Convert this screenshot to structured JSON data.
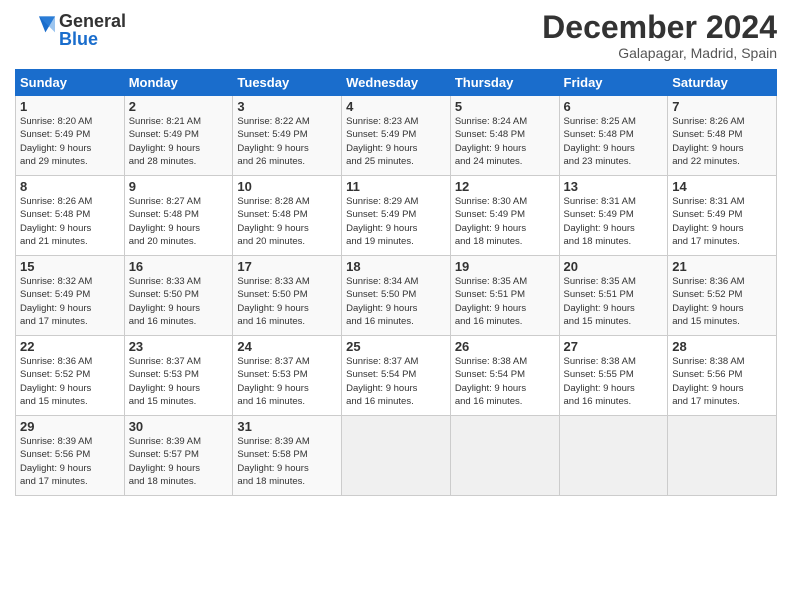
{
  "header": {
    "logo_general": "General",
    "logo_blue": "Blue",
    "month_title": "December 2024",
    "location": "Galapagar, Madrid, Spain"
  },
  "calendar": {
    "days_of_week": [
      "Sunday",
      "Monday",
      "Tuesday",
      "Wednesday",
      "Thursday",
      "Friday",
      "Saturday"
    ],
    "weeks": [
      [
        {
          "day": "",
          "info": ""
        },
        {
          "day": "",
          "info": ""
        },
        {
          "day": "",
          "info": ""
        },
        {
          "day": "",
          "info": ""
        },
        {
          "day": "5",
          "info": "Sunrise: 8:24 AM\nSunset: 5:48 PM\nDaylight: 9 hours\nand 24 minutes."
        },
        {
          "day": "6",
          "info": "Sunrise: 8:25 AM\nSunset: 5:48 PM\nDaylight: 9 hours\nand 23 minutes."
        },
        {
          "day": "7",
          "info": "Sunrise: 8:26 AM\nSunset: 5:48 PM\nDaylight: 9 hours\nand 22 minutes."
        }
      ],
      [
        {
          "day": "1",
          "info": "Sunrise: 8:20 AM\nSunset: 5:49 PM\nDaylight: 9 hours\nand 29 minutes."
        },
        {
          "day": "2",
          "info": "Sunrise: 8:21 AM\nSunset: 5:49 PM\nDaylight: 9 hours\nand 28 minutes."
        },
        {
          "day": "3",
          "info": "Sunrise: 8:22 AM\nSunset: 5:49 PM\nDaylight: 9 hours\nand 26 minutes."
        },
        {
          "day": "4",
          "info": "Sunrise: 8:23 AM\nSunset: 5:49 PM\nDaylight: 9 hours\nand 25 minutes."
        },
        {
          "day": "5",
          "info": "Sunrise: 8:24 AM\nSunset: 5:48 PM\nDaylight: 9 hours\nand 24 minutes."
        },
        {
          "day": "6",
          "info": "Sunrise: 8:25 AM\nSunset: 5:48 PM\nDaylight: 9 hours\nand 23 minutes."
        },
        {
          "day": "7",
          "info": "Sunrise: 8:26 AM\nSunset: 5:48 PM\nDaylight: 9 hours\nand 22 minutes."
        }
      ],
      [
        {
          "day": "8",
          "info": "Sunrise: 8:26 AM\nSunset: 5:48 PM\nDaylight: 9 hours\nand 21 minutes."
        },
        {
          "day": "9",
          "info": "Sunrise: 8:27 AM\nSunset: 5:48 PM\nDaylight: 9 hours\nand 20 minutes."
        },
        {
          "day": "10",
          "info": "Sunrise: 8:28 AM\nSunset: 5:48 PM\nDaylight: 9 hours\nand 20 minutes."
        },
        {
          "day": "11",
          "info": "Sunrise: 8:29 AM\nSunset: 5:49 PM\nDaylight: 9 hours\nand 19 minutes."
        },
        {
          "day": "12",
          "info": "Sunrise: 8:30 AM\nSunset: 5:49 PM\nDaylight: 9 hours\nand 18 minutes."
        },
        {
          "day": "13",
          "info": "Sunrise: 8:31 AM\nSunset: 5:49 PM\nDaylight: 9 hours\nand 18 minutes."
        },
        {
          "day": "14",
          "info": "Sunrise: 8:31 AM\nSunset: 5:49 PM\nDaylight: 9 hours\nand 17 minutes."
        }
      ],
      [
        {
          "day": "15",
          "info": "Sunrise: 8:32 AM\nSunset: 5:49 PM\nDaylight: 9 hours\nand 17 minutes."
        },
        {
          "day": "16",
          "info": "Sunrise: 8:33 AM\nSunset: 5:50 PM\nDaylight: 9 hours\nand 16 minutes."
        },
        {
          "day": "17",
          "info": "Sunrise: 8:33 AM\nSunset: 5:50 PM\nDaylight: 9 hours\nand 16 minutes."
        },
        {
          "day": "18",
          "info": "Sunrise: 8:34 AM\nSunset: 5:50 PM\nDaylight: 9 hours\nand 16 minutes."
        },
        {
          "day": "19",
          "info": "Sunrise: 8:35 AM\nSunset: 5:51 PM\nDaylight: 9 hours\nand 16 minutes."
        },
        {
          "day": "20",
          "info": "Sunrise: 8:35 AM\nSunset: 5:51 PM\nDaylight: 9 hours\nand 15 minutes."
        },
        {
          "day": "21",
          "info": "Sunrise: 8:36 AM\nSunset: 5:52 PM\nDaylight: 9 hours\nand 15 minutes."
        }
      ],
      [
        {
          "day": "22",
          "info": "Sunrise: 8:36 AM\nSunset: 5:52 PM\nDaylight: 9 hours\nand 15 minutes."
        },
        {
          "day": "23",
          "info": "Sunrise: 8:37 AM\nSunset: 5:53 PM\nDaylight: 9 hours\nand 15 minutes."
        },
        {
          "day": "24",
          "info": "Sunrise: 8:37 AM\nSunset: 5:53 PM\nDaylight: 9 hours\nand 16 minutes."
        },
        {
          "day": "25",
          "info": "Sunrise: 8:37 AM\nSunset: 5:54 PM\nDaylight: 9 hours\nand 16 minutes."
        },
        {
          "day": "26",
          "info": "Sunrise: 8:38 AM\nSunset: 5:54 PM\nDaylight: 9 hours\nand 16 minutes."
        },
        {
          "day": "27",
          "info": "Sunrise: 8:38 AM\nSunset: 5:55 PM\nDaylight: 9 hours\nand 16 minutes."
        },
        {
          "day": "28",
          "info": "Sunrise: 8:38 AM\nSunset: 5:56 PM\nDaylight: 9 hours\nand 17 minutes."
        }
      ],
      [
        {
          "day": "29",
          "info": "Sunrise: 8:39 AM\nSunset: 5:56 PM\nDaylight: 9 hours\nand 17 minutes."
        },
        {
          "day": "30",
          "info": "Sunrise: 8:39 AM\nSunset: 5:57 PM\nDaylight: 9 hours\nand 18 minutes."
        },
        {
          "day": "31",
          "info": "Sunrise: 8:39 AM\nSunset: 5:58 PM\nDaylight: 9 hours\nand 18 minutes."
        },
        {
          "day": "",
          "info": ""
        },
        {
          "day": "",
          "info": ""
        },
        {
          "day": "",
          "info": ""
        },
        {
          "day": "",
          "info": ""
        }
      ]
    ],
    "week1": [
      {
        "day": "1",
        "info": "Sunrise: 8:20 AM\nSunset: 5:49 PM\nDaylight: 9 hours\nand 29 minutes."
      },
      {
        "day": "2",
        "info": "Sunrise: 8:21 AM\nSunset: 5:49 PM\nDaylight: 9 hours\nand 28 minutes."
      },
      {
        "day": "3",
        "info": "Sunrise: 8:22 AM\nSunset: 5:49 PM\nDaylight: 9 hours\nand 26 minutes."
      },
      {
        "day": "4",
        "info": "Sunrise: 8:23 AM\nSunset: 5:49 PM\nDaylight: 9 hours\nand 25 minutes."
      },
      {
        "day": "5",
        "info": "Sunrise: 8:24 AM\nSunset: 5:48 PM\nDaylight: 9 hours\nand 24 minutes."
      },
      {
        "day": "6",
        "info": "Sunrise: 8:25 AM\nSunset: 5:48 PM\nDaylight: 9 hours\nand 23 minutes."
      },
      {
        "day": "7",
        "info": "Sunrise: 8:26 AM\nSunset: 5:48 PM\nDaylight: 9 hours\nand 22 minutes."
      }
    ]
  }
}
